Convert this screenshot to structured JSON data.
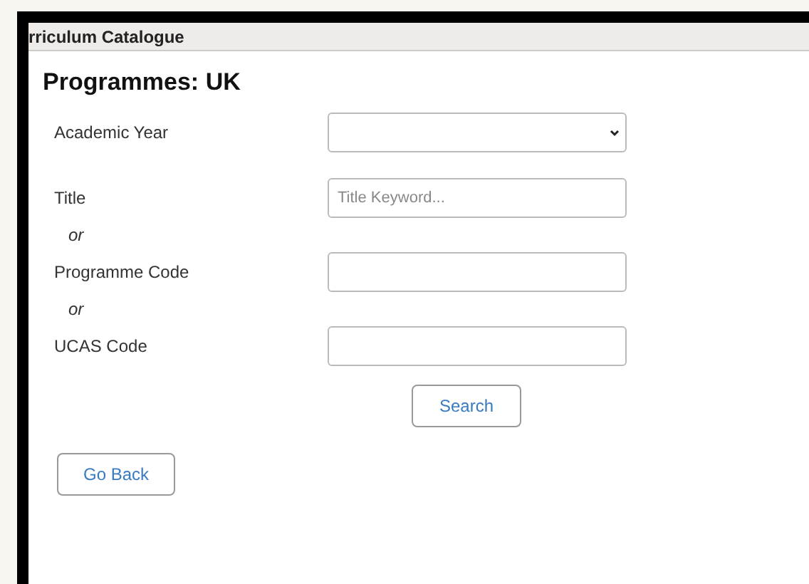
{
  "window": {
    "title": "rriculum Catalogue"
  },
  "heading": "Programmes: UK",
  "rows": [
    {
      "kind": "select",
      "label": "Academic Year"
    },
    {
      "kind": "text",
      "label": "Title",
      "placeholder": "Title Keyword..."
    },
    {
      "kind": "separator",
      "label": "or"
    },
    {
      "kind": "text",
      "label": "Programme Code"
    },
    {
      "kind": "separator",
      "label": "or"
    },
    {
      "kind": "text",
      "label": "UCAS Code"
    }
  ],
  "search_button": "Search",
  "back_button": "Go Back"
}
